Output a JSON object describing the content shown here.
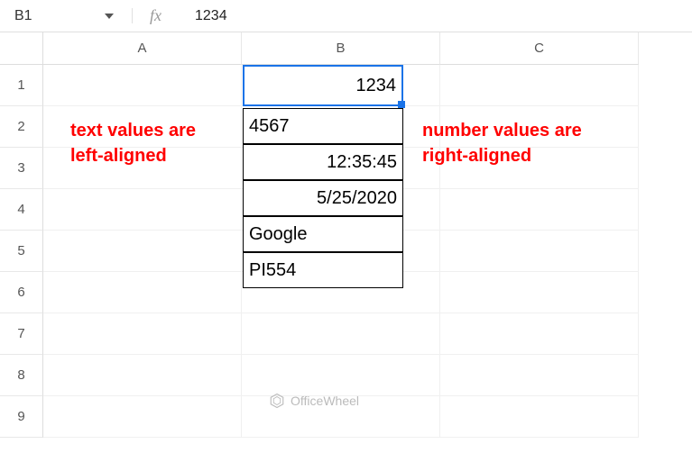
{
  "formula_bar": {
    "cell_ref": "B1",
    "fx_label": "fx",
    "value": "1234"
  },
  "columns": [
    "A",
    "B",
    "C"
  ],
  "rows": [
    "1",
    "2",
    "3",
    "4",
    "5",
    "6",
    "7",
    "8",
    "9"
  ],
  "cells": {
    "B1": {
      "v": "1234",
      "align": "right",
      "selected": true
    },
    "B2": {
      "v": "4567",
      "align": "left"
    },
    "B3": {
      "v": "12:35:45",
      "align": "right"
    },
    "B4": {
      "v": "5/25/2020",
      "align": "right"
    },
    "B5": {
      "v": "Google",
      "align": "left"
    },
    "B6": {
      "v": "PI554",
      "align": "left"
    }
  },
  "annotations": {
    "left": "text values are left-aligned",
    "right": "number values are right-aligned"
  },
  "watermark": "OfficeWheel"
}
